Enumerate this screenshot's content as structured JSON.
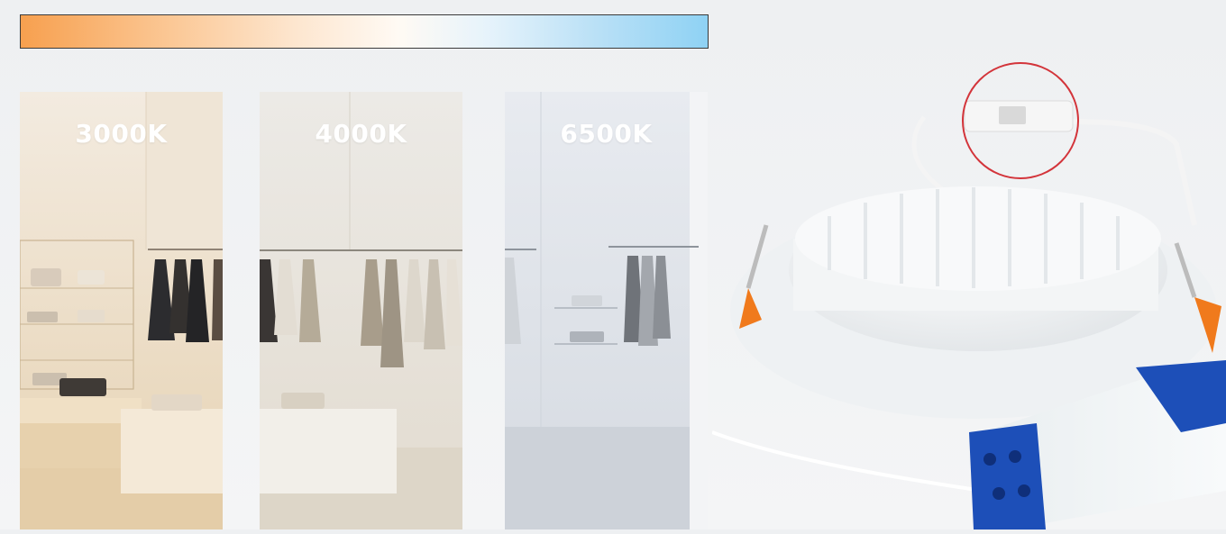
{
  "gradient": {
    "colors": [
      "#f7a04f",
      "#fde6cf",
      "#fffaf4",
      "#b9e0f6",
      "#8fd2f4"
    ]
  },
  "panels": [
    {
      "label": "3000K",
      "tone": "#f1e2c9"
    },
    {
      "label": "4000K",
      "tone": "#ece6dc"
    },
    {
      "label": "6500K",
      "tone": "#dfe3e8"
    }
  ],
  "product": {
    "accent_color": "#f07a1c",
    "driver_color": "#1d4fb8",
    "switch_highlight_color": "#d3343a"
  }
}
